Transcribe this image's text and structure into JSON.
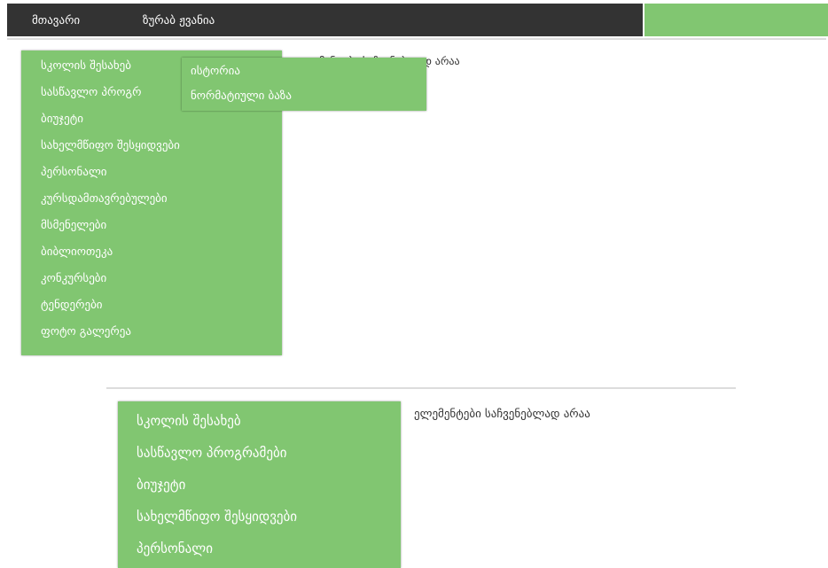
{
  "nav": {
    "items": [
      {
        "label": "მთავარი"
      },
      {
        "label": "ზურაბ ჟვანია"
      }
    ]
  },
  "colors": {
    "nav_bg": "#333333",
    "menu_green": "#81c671",
    "menu_text": "#ffffff",
    "divider": "#dcdcdc"
  },
  "dropdown_top": {
    "items": [
      {
        "label": "სკოლის შესახებ"
      },
      {
        "label": "სასწავლო პროგრ"
      },
      {
        "label": "ბიუჯეტი"
      },
      {
        "label": "სახელმწიფო შესყიდვები"
      },
      {
        "label": "პერსონალი"
      },
      {
        "label": "კურსდამთავრებულები"
      },
      {
        "label": "მსმენელები"
      },
      {
        "label": "ბიბლიოთეკა"
      },
      {
        "label": "კონკურსები"
      },
      {
        "label": "ტენდერები"
      },
      {
        "label": "ფოტო გალერეა"
      }
    ],
    "submenu": [
      {
        "label": "ისტორია"
      },
      {
        "label": "ნორმატიული ბაზა"
      }
    ],
    "note": "მენტები საჩვენებლად არაა"
  },
  "dropdown_bottom": {
    "items": [
      {
        "label": "სკოლის შესახებ"
      },
      {
        "label": "სასწავლო პროგრამები"
      },
      {
        "label": "ბიუჯეტი"
      },
      {
        "label": "სახელმწიფო შესყიდვები"
      },
      {
        "label": "პერსონალი"
      }
    ],
    "note": "ელემენტები საჩვენებლად არაა"
  }
}
